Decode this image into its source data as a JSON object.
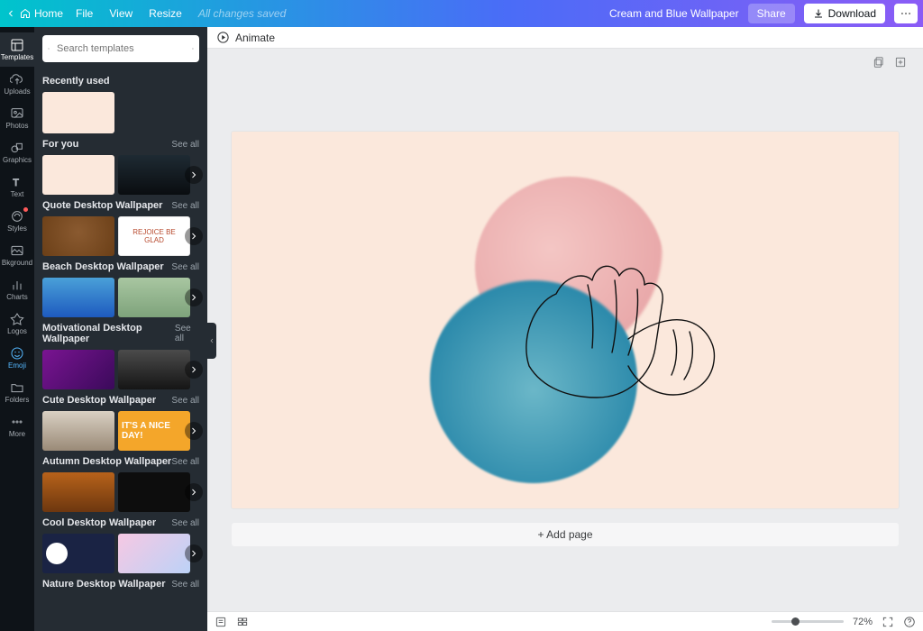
{
  "topbar": {
    "home": "Home",
    "menu": [
      "File",
      "View",
      "Resize"
    ],
    "saved": "All changes saved",
    "doc_title": "Cream and Blue Wallpaper",
    "share": "Share",
    "download": "Download"
  },
  "rail": [
    {
      "key": "templates",
      "label": "Templates",
      "active": true
    },
    {
      "key": "uploads",
      "label": "Uploads"
    },
    {
      "key": "photos",
      "label": "Photos"
    },
    {
      "key": "graphics",
      "label": "Graphics"
    },
    {
      "key": "text",
      "label": "Text"
    },
    {
      "key": "styles",
      "label": "Styles",
      "dot": true
    },
    {
      "key": "bkground",
      "label": "Bkground"
    },
    {
      "key": "charts",
      "label": "Charts"
    },
    {
      "key": "logos",
      "label": "Logos"
    },
    {
      "key": "emoji",
      "label": "Emoji",
      "emoji": true
    },
    {
      "key": "folders",
      "label": "Folders"
    },
    {
      "key": "more",
      "label": "More"
    }
  ],
  "search": {
    "placeholder": "Search templates"
  },
  "sections": {
    "recent": {
      "title": "Recently used"
    },
    "foryou": {
      "title": "For you",
      "see_all": "See all"
    },
    "quote": {
      "title": "Quote Desktop Wallpaper",
      "see_all": "See all",
      "card_text": "REJOICE\nBE GLAD"
    },
    "beach": {
      "title": "Beach Desktop Wallpaper",
      "see_all": "See all"
    },
    "motiv": {
      "title": "Motivational Desktop Wallpaper",
      "see_all": "See all"
    },
    "cute": {
      "title": "Cute Desktop Wallpaper",
      "see_all": "See all",
      "card_text": "IT'S A NICE DAY!"
    },
    "autumn": {
      "title": "Autumn Desktop Wallpaper",
      "see_all": "See all"
    },
    "cool": {
      "title": "Cool Desktop Wallpaper",
      "see_all": "See all"
    },
    "nature": {
      "title": "Nature Desktop Wallpaper",
      "see_all": "See all"
    }
  },
  "editor": {
    "animate": "Animate",
    "add_page": "+ Add page"
  },
  "status": {
    "zoom": "72%"
  }
}
